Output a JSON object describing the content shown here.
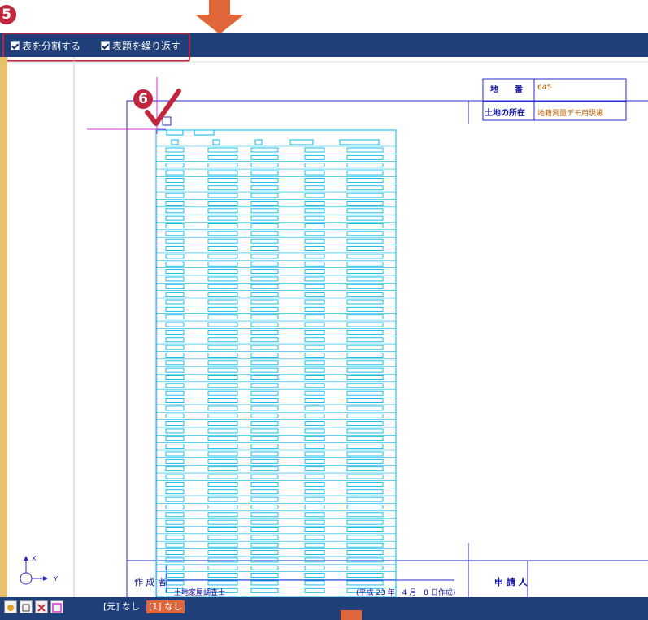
{
  "toolbar": {
    "option_split_table": "表を分割する",
    "option_repeat_header": "表題を繰り返す",
    "split_table_checked": true,
    "repeat_header_checked": true
  },
  "steps": {
    "step5": "5",
    "step6": "6"
  },
  "drawing": {
    "land_number_label": "地　　番",
    "land_number_value": "645",
    "location_label": "土地の所在",
    "location_value": "地籍測量デモ用現場",
    "author_label": "作 成 者",
    "author_value": "土地家屋調査士",
    "date_value": "(平成 23 年　4 月　8 日作成)",
    "applicant_label": "申 請 人",
    "axis_x": "X",
    "axis_y": "Y"
  },
  "statusbar": {
    "source_label": "[元] なし",
    "layer_label": "[1] なし"
  },
  "colors": {
    "toolbar_bg": "#1f3f7a",
    "highlight_red": "#c2263d",
    "arrow_orange": "#e0663a",
    "table_cyan": "#00b8e8",
    "frame_blue": "#2a2ad0",
    "magenta": "#d033d0"
  }
}
